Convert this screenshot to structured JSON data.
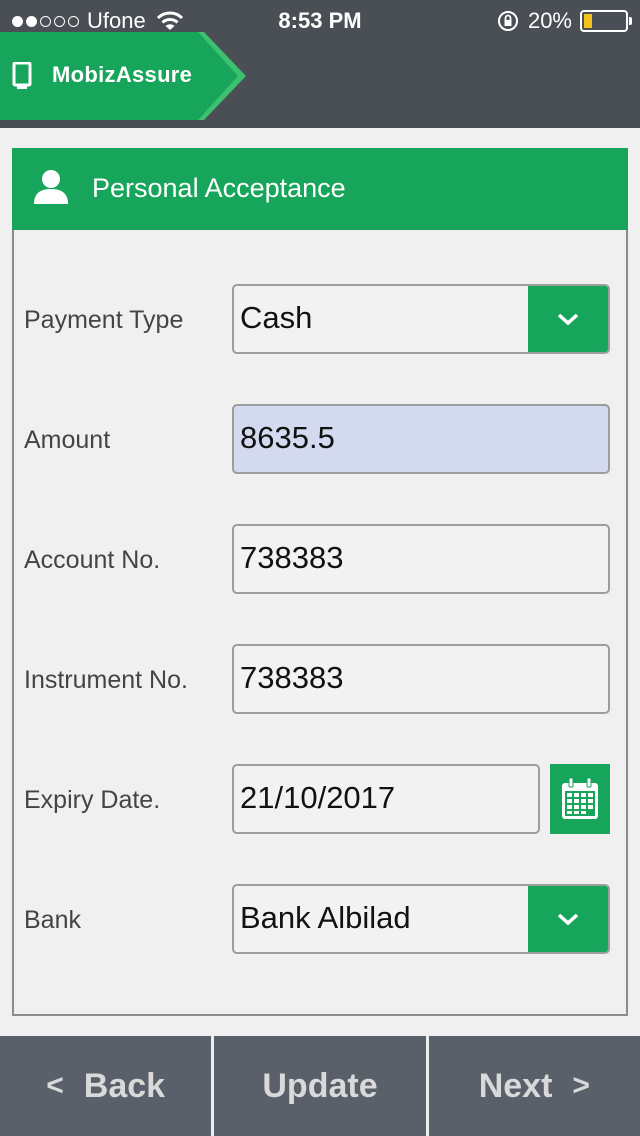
{
  "status_bar": {
    "carrier": "Ufone",
    "time": "8:53 PM",
    "battery_percent": "20%",
    "battery_level": 0.2,
    "signal_bars": 2
  },
  "app": {
    "name": "MobizAssure"
  },
  "section": {
    "title": "Personal Acceptance"
  },
  "form": {
    "payment_type": {
      "label": "Payment Type",
      "value": "Cash"
    },
    "amount": {
      "label": "Amount",
      "value": "8635.5"
    },
    "account_no": {
      "label": "Account No.",
      "value": "738383"
    },
    "instrument_no": {
      "label": "Instrument No.",
      "value": "738383"
    },
    "expiry_date": {
      "label": "Expiry Date.",
      "value": "21/10/2017"
    },
    "bank": {
      "label": "Bank",
      "value": "Bank Albilad"
    }
  },
  "bottom_bar": {
    "back_label": "Back",
    "update_label": "Update",
    "next_label": "Next",
    "back_arrow": "<",
    "next_arrow": ">"
  },
  "icons": {
    "brand": "phone-icon",
    "header": "user-icon",
    "dropdown": "chevron-down-icon",
    "date": "calendar-icon"
  },
  "colors": {
    "accent_green": "#16a55a",
    "top_bar": "#4a4e55",
    "bottom_bar": "#59606a",
    "highlight_field": "#d3d9ef"
  }
}
